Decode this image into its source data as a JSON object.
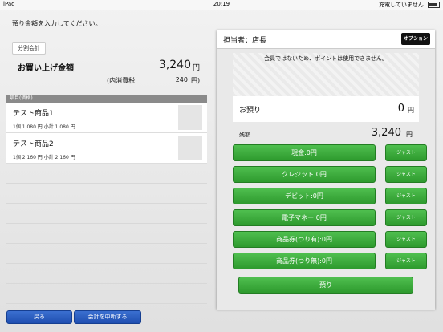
{
  "status": {
    "device": "iPad",
    "time": "20:19",
    "charge": "充電していません"
  },
  "prompt": "預り金額を入力してください。",
  "split_label": "分割会計",
  "total": {
    "label": "お買い上げ金額",
    "value": "3,240",
    "yen": "円",
    "tax_label": "(内消費税",
    "tax_value": "240",
    "tax_yen": "円)"
  },
  "list": {
    "header": "項目(価格)",
    "items": [
      {
        "name": "テスト商品1",
        "detail": "1個 1,080 円  小計 1,080 円"
      },
      {
        "name": "テスト商品2",
        "detail": "1個 2,160 円  小計 2,160 円"
      }
    ]
  },
  "buttons": {
    "back": "戻る",
    "suspend": "会計を中断する"
  },
  "panel": {
    "staff": "担当者：店長",
    "option": "オプション",
    "member_note": "会員ではないため、ポイントは使用できません。",
    "deposit_label": "お預り",
    "deposit_value": "0",
    "deposit_yen": "円",
    "change_label": "残額",
    "change_value": "3,240",
    "change_yen": "円",
    "methods": [
      {
        "label": "現金:0円",
        "just": "ジャスト"
      },
      {
        "label": "クレジット:0円",
        "just": "ジャスト"
      },
      {
        "label": "デビット:0円",
        "just": "ジャスト"
      },
      {
        "label": "電子マネー:0円",
        "just": "ジャスト"
      },
      {
        "label": "商品券(つり有):0円",
        "just": "ジャスト"
      },
      {
        "label": "商品券(つり無):0円",
        "just": "ジャスト"
      }
    ],
    "submit": "預り"
  }
}
